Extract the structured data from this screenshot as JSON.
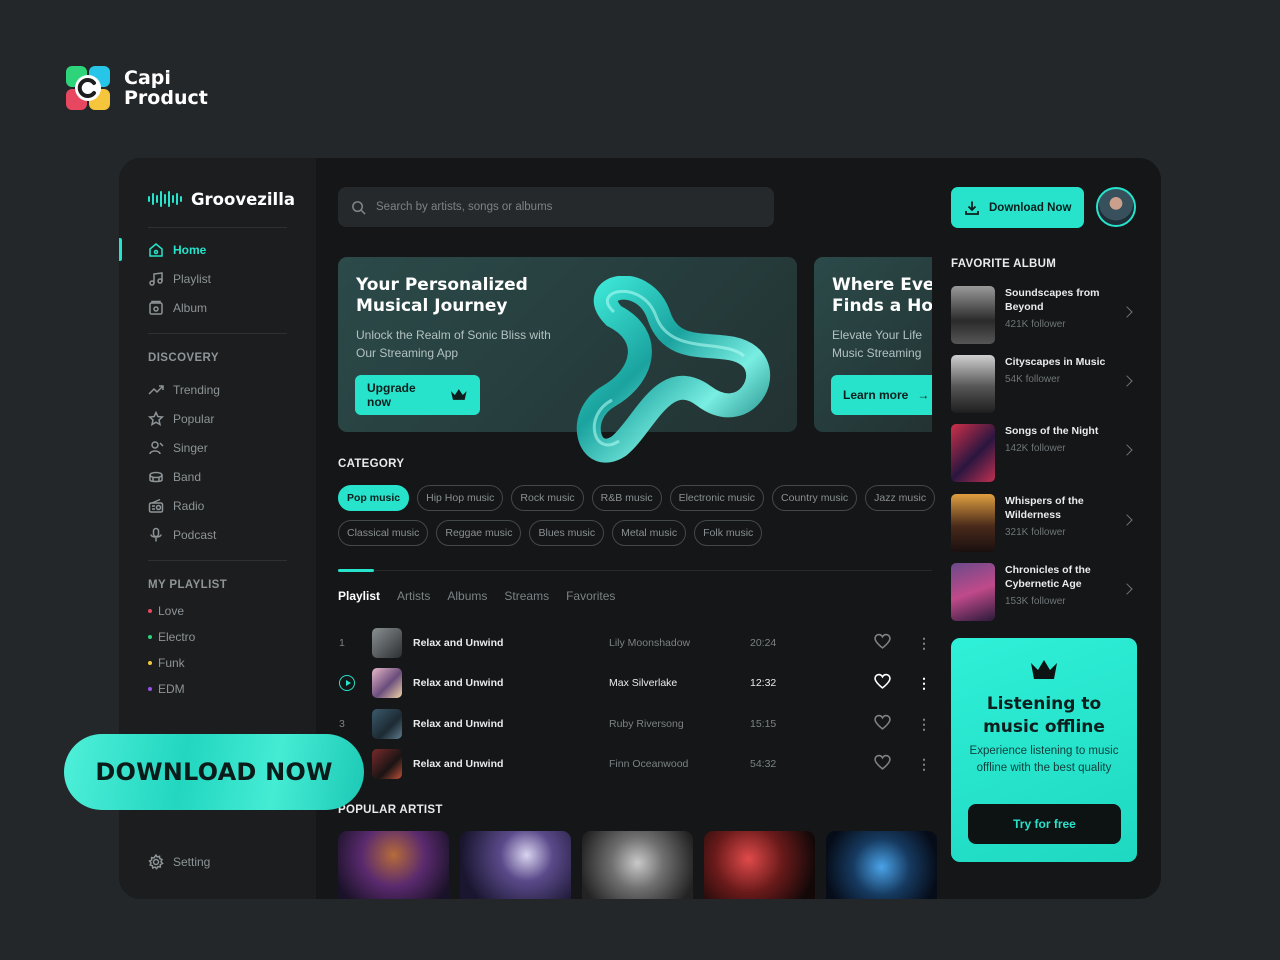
{
  "brand": {
    "line1": "Capi",
    "line2": "Product"
  },
  "app": {
    "name": "Groovezilla"
  },
  "sidebar": {
    "nav": [
      {
        "label": "Home",
        "icon": "home-icon",
        "active": true
      },
      {
        "label": "Playlist",
        "icon": "music-note-icon"
      },
      {
        "label": "Album",
        "icon": "album-icon"
      }
    ],
    "discovery_title": "DISCOVERY",
    "discovery": [
      {
        "label": "Trending",
        "icon": "trending-icon"
      },
      {
        "label": "Popular",
        "icon": "star-icon"
      },
      {
        "label": "Singer",
        "icon": "singer-icon"
      },
      {
        "label": "Band",
        "icon": "band-icon"
      },
      {
        "label": "Radio",
        "icon": "radio-icon"
      },
      {
        "label": "Podcast",
        "icon": "microphone-icon"
      }
    ],
    "playlist_title": "MY PLAYLIST",
    "playlists": [
      {
        "label": "Love",
        "color": "#e8485f"
      },
      {
        "label": "Electro",
        "color": "#2ed47a"
      },
      {
        "label": "Funk",
        "color": "#f5c53b"
      },
      {
        "label": "EDM",
        "color": "#9b4df0"
      }
    ],
    "setting": "Setting"
  },
  "search": {
    "placeholder": "Search by artists, songs or albums"
  },
  "banners": [
    {
      "title_line1": "Your Personalized",
      "title_line2": "Musical Journey",
      "desc_line1": "Unlock the Realm of Sonic Bliss with",
      "desc_line2": "Our Streaming App",
      "button": "Upgrade now"
    },
    {
      "title_line1": "Where Ever",
      "title_line2": "Finds a Hon",
      "desc_line1": "Elevate Your Life",
      "desc_line2": "Music Streaming",
      "button": "Learn more"
    }
  ],
  "category": {
    "title": "CATEGORY",
    "chips": [
      "Pop music",
      "Hip Hop music",
      "Rock music",
      "R&B music",
      "Electronic music",
      "Country music",
      "Jazz music",
      "Classical music",
      "Reggae music",
      "Blues music",
      "Metal music",
      "Folk music"
    ],
    "active": "Pop music"
  },
  "tabs": [
    "Playlist",
    "Artists",
    "Albums",
    "Streams",
    "Favorites"
  ],
  "tracks": [
    {
      "num": "1",
      "title": "Relax and Unwind",
      "artist": "Lily Moonshadow",
      "duration": "20:24"
    },
    {
      "num": "",
      "title": "Relax and Unwind",
      "artist": "Max Silverlake",
      "duration": "12:32",
      "playing": true
    },
    {
      "num": "3",
      "title": "Relax and Unwind",
      "artist": "Ruby Riversong",
      "duration": "15:15"
    },
    {
      "num": "",
      "title": "Relax and Unwind",
      "artist": "Finn Oceanwood",
      "duration": "54:32"
    }
  ],
  "popular_artist_title": "POPULAR ARTIST",
  "right": {
    "download_button": "Download Now",
    "favorite_title": "FAVORITE ALBUM",
    "albums": [
      {
        "name": "Soundscapes from Beyond",
        "followers": "421K follower"
      },
      {
        "name": "Cityscapes in Music",
        "followers": "54K follower"
      },
      {
        "name": "Songs of the Night",
        "followers": "142K follower"
      },
      {
        "name": "Whispers of the Wilderness",
        "followers": "321K follower"
      },
      {
        "name": "Chronicles of the Cybernetic Age",
        "followers": "153K follower"
      }
    ],
    "promo": {
      "title_line1": "Listening to",
      "title_line2": "music offline",
      "desc": "Experience listening to music offline with the best quality",
      "button": "Try for free"
    }
  },
  "overlay": {
    "download_now": "DOWNLOAD NOW"
  },
  "colors": {
    "accent": "#27e3cc",
    "background": "#23272a",
    "window": "#141617"
  }
}
